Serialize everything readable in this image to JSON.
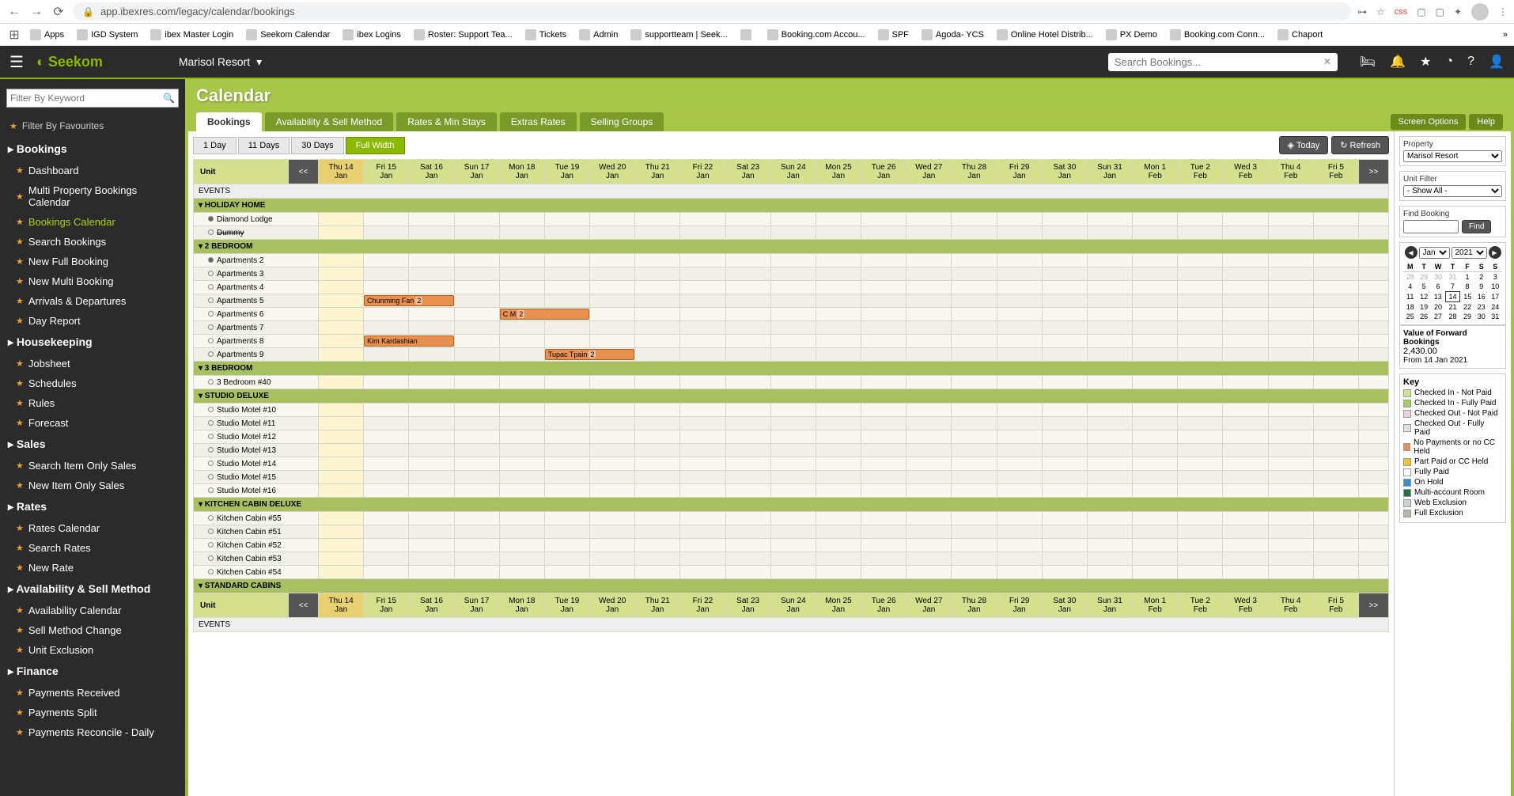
{
  "browser": {
    "url": "app.ibexres.com/legacy/calendar/bookings",
    "bookmarks": [
      "Apps",
      "IGD System",
      "ibex Master Login",
      "Seekom Calendar",
      "ibex Logins",
      "Roster: Support Tea...",
      "Tickets",
      "Admin",
      "supportteam | Seek...",
      "",
      "Booking.com Accou...",
      "SPF",
      "Agoda- YCS",
      "Online Hotel Distrib...",
      "PX Demo",
      "Booking.com Conn...",
      "Chaport"
    ]
  },
  "header": {
    "logo": "Seekom",
    "property": "Marisol Resort",
    "search_placeholder": "Search Bookings..."
  },
  "sidebar": {
    "filter_placeholder": "Filter By Keyword",
    "fav_filter": "Filter By Favourites",
    "sections": [
      {
        "title": "Bookings",
        "items": [
          "Dashboard",
          "Multi Property Bookings Calendar",
          "Bookings Calendar",
          "Search Bookings",
          "New Full Booking",
          "New Multi Booking",
          "Arrivals & Departures",
          "Day Report"
        ]
      },
      {
        "title": "Housekeeping",
        "items": [
          "Jobsheet",
          "Schedules",
          "Rules",
          "Forecast"
        ]
      },
      {
        "title": "Sales",
        "items": [
          "Search Item Only Sales",
          "New Item Only Sales"
        ]
      },
      {
        "title": "Rates",
        "items": [
          "Rates Calendar",
          "Search Rates",
          "New Rate"
        ]
      },
      {
        "title": "Availability & Sell Method",
        "items": [
          "Availability Calendar",
          "Sell Method Change",
          "Unit Exclusion"
        ]
      },
      {
        "title": "Finance",
        "items": [
          "Payments Received",
          "Payments Split",
          "Payments Reconcile - Daily"
        ]
      }
    ],
    "active": "Bookings Calendar"
  },
  "page": {
    "title": "Calendar",
    "tabs": [
      "Bookings",
      "Availability & Sell Method",
      "Rates & Min Stays",
      "Extras Rates",
      "Selling Groups"
    ],
    "active_tab": "Bookings",
    "right_buttons": [
      "Screen Options",
      "Help"
    ],
    "view_buttons": [
      "1 Day",
      "11 Days",
      "30 Days",
      "Full Width"
    ],
    "active_view": "Full Width",
    "today_btn": "Today",
    "refresh_btn": "Refresh"
  },
  "calendar": {
    "unit_header": "Unit",
    "prev": "<<",
    "next": ">>",
    "dates": [
      {
        "d": "Thu 14",
        "m": "Jan",
        "today": true
      },
      {
        "d": "Fri 15",
        "m": "Jan"
      },
      {
        "d": "Sat 16",
        "m": "Jan"
      },
      {
        "d": "Sun 17",
        "m": "Jan"
      },
      {
        "d": "Mon 18",
        "m": "Jan"
      },
      {
        "d": "Tue 19",
        "m": "Jan"
      },
      {
        "d": "Wed 20",
        "m": "Jan"
      },
      {
        "d": "Thu 21",
        "m": "Jan"
      },
      {
        "d": "Fri 22",
        "m": "Jan"
      },
      {
        "d": "Sat 23",
        "m": "Jan"
      },
      {
        "d": "Sun 24",
        "m": "Jan"
      },
      {
        "d": "Mon 25",
        "m": "Jan"
      },
      {
        "d": "Tue 26",
        "m": "Jan"
      },
      {
        "d": "Wed 27",
        "m": "Jan"
      },
      {
        "d": "Thu 28",
        "m": "Jan"
      },
      {
        "d": "Fri 29",
        "m": "Jan"
      },
      {
        "d": "Sat 30",
        "m": "Jan"
      },
      {
        "d": "Sun 31",
        "m": "Jan"
      },
      {
        "d": "Mon 1",
        "m": "Feb"
      },
      {
        "d": "Tue 2",
        "m": "Feb"
      },
      {
        "d": "Wed 3",
        "m": "Feb"
      },
      {
        "d": "Thu 4",
        "m": "Feb"
      },
      {
        "d": "Fri 5",
        "m": "Feb"
      }
    ],
    "events_label": "EVENTS",
    "categories": [
      {
        "name": "HOLIDAY HOME",
        "units": [
          {
            "name": "Diamond Lodge",
            "filled": true,
            "bookings": []
          },
          {
            "name": "Dummy",
            "filled": false,
            "strike": true,
            "bookings": []
          }
        ]
      },
      {
        "name": "2 BEDROOM",
        "units": [
          {
            "name": "Apartments 2",
            "filled": true,
            "bookings": []
          },
          {
            "name": "Apartments 3",
            "filled": false,
            "bookings": []
          },
          {
            "name": "Apartments 4",
            "filled": false,
            "bookings": []
          },
          {
            "name": "Apartments 5",
            "filled": false,
            "bookings": [
              {
                "label": "Chunming Fan",
                "start": 1,
                "span": 2,
                "badge": "2"
              }
            ]
          },
          {
            "name": "Apartments 6",
            "filled": false,
            "bookings": [
              {
                "label": "C M",
                "start": 4,
                "span": 2,
                "badge": "2"
              }
            ]
          },
          {
            "name": "Apartments 7",
            "filled": false,
            "bookings": []
          },
          {
            "name": "Apartments 8",
            "filled": false,
            "bookings": [
              {
                "label": "Kim Kardashian",
                "start": 1,
                "span": 2,
                "badge": ""
              }
            ]
          },
          {
            "name": "Apartments 9",
            "filled": false,
            "bookings": [
              {
                "label": "Tupac Tpain",
                "start": 5,
                "span": 2,
                "badge": "2"
              }
            ]
          }
        ]
      },
      {
        "name": "3 BEDROOM",
        "units": [
          {
            "name": "3 Bedroom #40",
            "filled": false,
            "bookings": []
          }
        ]
      },
      {
        "name": "STUDIO DELUXE",
        "units": [
          {
            "name": "Studio Motel #10",
            "filled": false,
            "bookings": []
          },
          {
            "name": "Studio Motel #11",
            "filled": false,
            "bookings": []
          },
          {
            "name": "Studio Motel #12",
            "filled": false,
            "bookings": []
          },
          {
            "name": "Studio Motel #13",
            "filled": false,
            "bookings": []
          },
          {
            "name": "Studio Motel #14",
            "filled": false,
            "bookings": []
          },
          {
            "name": "Studio Motel #15",
            "filled": false,
            "bookings": []
          },
          {
            "name": "Studio Motel #16",
            "filled": false,
            "bookings": []
          }
        ]
      },
      {
        "name": "KITCHEN CABIN DELUXE",
        "units": [
          {
            "name": "Kitchen Cabin #55",
            "filled": false,
            "bookings": []
          },
          {
            "name": "Kitchen Cabin #51",
            "filled": false,
            "bookings": []
          },
          {
            "name": "Kitchen Cabin #52",
            "filled": false,
            "bookings": []
          },
          {
            "name": "Kitchen Cabin #53",
            "filled": false,
            "bookings": []
          },
          {
            "name": "Kitchen Cabin #54",
            "filled": false,
            "bookings": []
          }
        ]
      },
      {
        "name": "STANDARD CABINS",
        "units": []
      }
    ]
  },
  "right": {
    "property_label": "Property",
    "property_value": "Marisol Resort",
    "unit_filter_label": "Unit Filter",
    "unit_filter_value": "- Show All -",
    "find_label": "Find Booking",
    "find_btn": "Find",
    "month": "Jan",
    "year": "2021",
    "days": [
      "M",
      "T",
      "W",
      "T",
      "F",
      "S",
      "S"
    ],
    "weeks": [
      [
        {
          "n": 28,
          "o": true
        },
        {
          "n": 29,
          "o": true
        },
        {
          "n": 30,
          "o": true
        },
        {
          "n": 31,
          "o": true
        },
        {
          "n": 1
        },
        {
          "n": 2
        },
        {
          "n": 3
        }
      ],
      [
        {
          "n": 4
        },
        {
          "n": 5
        },
        {
          "n": 6
        },
        {
          "n": 7
        },
        {
          "n": 8
        },
        {
          "n": 9
        },
        {
          "n": 10
        }
      ],
      [
        {
          "n": 11
        },
        {
          "n": 12
        },
        {
          "n": 13
        },
        {
          "n": 14,
          "t": true
        },
        {
          "n": 15
        },
        {
          "n": 16
        },
        {
          "n": 17
        }
      ],
      [
        {
          "n": 18
        },
        {
          "n": 19
        },
        {
          "n": 20
        },
        {
          "n": 21
        },
        {
          "n": 22
        },
        {
          "n": 23
        },
        {
          "n": 24
        }
      ],
      [
        {
          "n": 25
        },
        {
          "n": 26
        },
        {
          "n": 27
        },
        {
          "n": 28
        },
        {
          "n": 29
        },
        {
          "n": 30
        },
        {
          "n": 31
        }
      ]
    ],
    "value_label": "Value of Forward Bookings",
    "value_amount": "2,430.00",
    "value_from": "From 14 Jan 2021",
    "key_label": "Key",
    "keys": [
      {
        "c": "#c8e890",
        "t": "Checked In - Not Paid"
      },
      {
        "c": "#a0d060",
        "t": "Checked In - Fully Paid"
      },
      {
        "c": "#f0d0e0",
        "t": "Checked Out - Not Paid"
      },
      {
        "c": "#e0e0e0",
        "t": "Checked Out - Fully Paid"
      },
      {
        "c": "#e89050",
        "t": "No Payments or no CC Held"
      },
      {
        "c": "#f0c030",
        "t": "Part Paid or CC Held"
      },
      {
        "c": "#ffffff",
        "t": "Fully Paid"
      },
      {
        "c": "#3090d0",
        "t": "On Hold"
      },
      {
        "c": "#207040",
        "t": "Multi-account Room"
      },
      {
        "c": "#d0d0d0",
        "t": "Web Exclusion"
      },
      {
        "c": "#b8b8a0",
        "t": "Full Exclusion"
      }
    ]
  }
}
